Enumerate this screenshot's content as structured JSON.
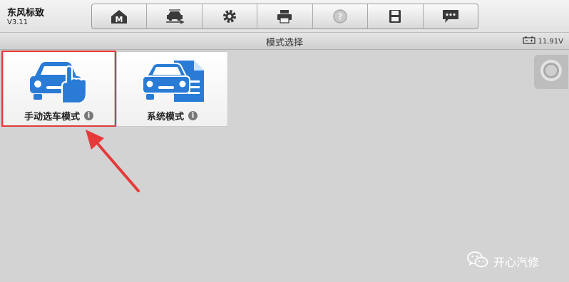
{
  "app": {
    "title": "东风标致",
    "version": "V3.11"
  },
  "toolbar": {
    "buttons": [
      {
        "icon": "home-m-icon"
      },
      {
        "icon": "vehicle-swap-icon"
      },
      {
        "icon": "gear-icon"
      },
      {
        "icon": "printer-icon"
      },
      {
        "icon": "help-icon"
      },
      {
        "icon": "save-icon"
      },
      {
        "icon": "message-icon"
      }
    ]
  },
  "subbar": {
    "title": "模式选择",
    "battery_voltage": "11.91V",
    "battery_icon": "battery-icon"
  },
  "tiles": [
    {
      "label": "手动选车模式",
      "icon": "car-hand-icon",
      "info_icon": "info-icon",
      "selected": true
    },
    {
      "label": "系统模式",
      "icon": "car-document-icon",
      "info_icon": "info-icon"
    }
  ],
  "annotation": {
    "arrow_color": "#e53a3a",
    "highlight_color": "#e53a3a"
  },
  "watermark": {
    "text": "开心汽修",
    "icon": "wechat-icon"
  },
  "colors": {
    "accent": "#2a7bd6"
  }
}
